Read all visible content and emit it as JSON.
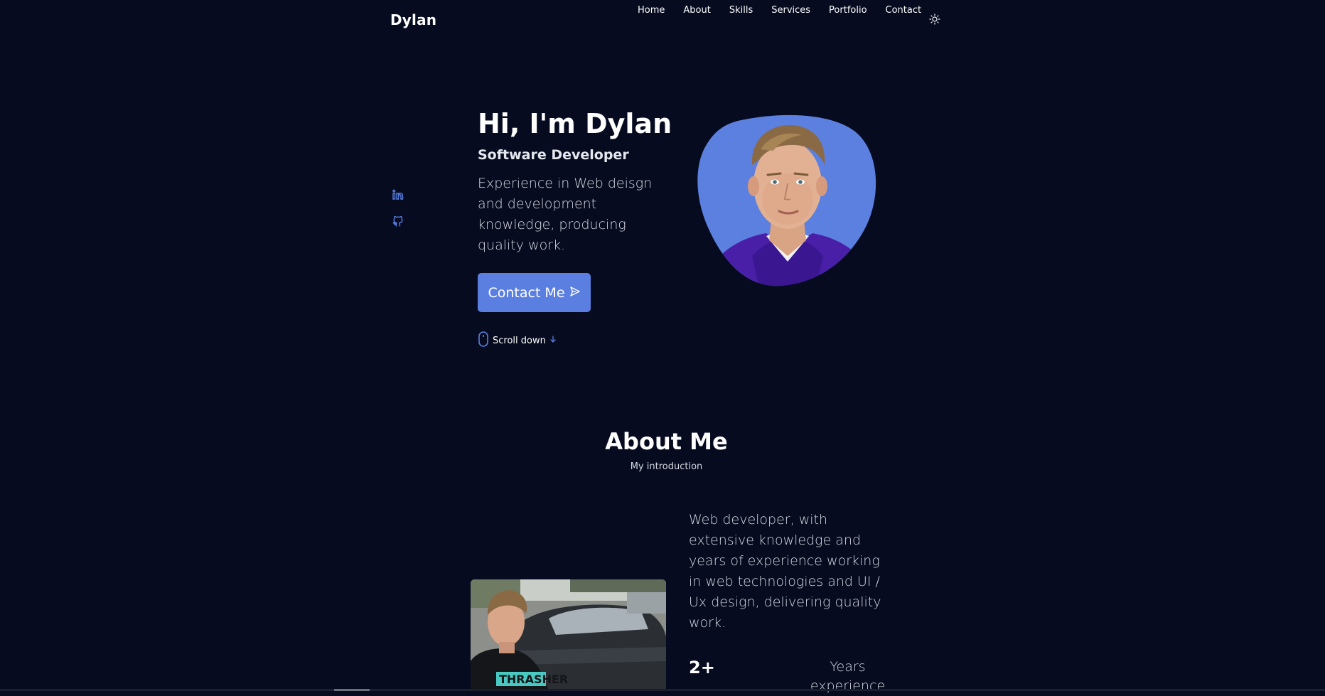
{
  "header": {
    "logo": "Dylan",
    "nav": [
      "Home",
      "About",
      "Skills",
      "Services",
      "Portfolio",
      "Contact"
    ],
    "theme_toggle_icon": "sun-icon"
  },
  "hero": {
    "title": "Hi, I'm Dylan",
    "subtitle": "Software Developer",
    "description": "Experience in Web deisgn and development knowledge, producing quality work.",
    "contact_button": "Contact Me",
    "contact_icon": "send-icon",
    "scroll_down": "Scroll down",
    "social_icons": [
      "linkedin-icon",
      "github-icon"
    ],
    "blob_color": "#5b80e0"
  },
  "about": {
    "title": "About Me",
    "subtitle": "My introduction",
    "description": "Web developer, with extensive knowledge and years of experience working in web technologies and UI / Ux design, delivering quality work.",
    "stat_value": "2+",
    "stat_label": "Years experience"
  },
  "colors": {
    "background": "#060b1f",
    "accent": "#5b7fe0",
    "text": "#ffffff",
    "muted_text": "#d6d8e1"
  }
}
